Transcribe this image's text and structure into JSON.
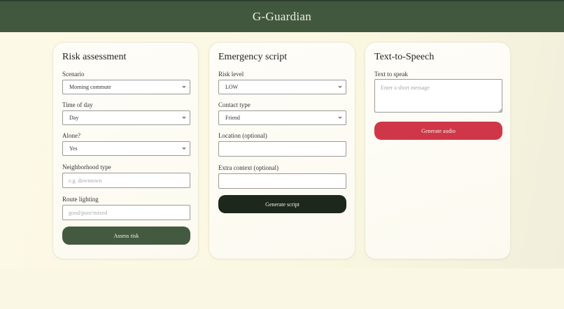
{
  "app": {
    "title": "G-Guardian"
  },
  "colors": {
    "header": "#41583f",
    "assess": "#435a41",
    "script": "#1d271c",
    "audio": "#cf3749"
  },
  "risk": {
    "title": "Risk assessment",
    "scenario": {
      "label": "Scenario",
      "value": "Morning commute"
    },
    "time": {
      "label": "Time of day",
      "value": "Day"
    },
    "alone": {
      "label": "Alone?",
      "value": "Yes"
    },
    "neighborhood": {
      "label": "Neighborhood type",
      "placeholder": "e.g. downtown"
    },
    "lighting": {
      "label": "Route lighting",
      "placeholder": "good/poor/mixed"
    },
    "button": "Assess risk"
  },
  "script": {
    "title": "Emergency script",
    "risk_level": {
      "label": "Risk level",
      "value": "LOW"
    },
    "contact": {
      "label": "Contact type",
      "value": "Friend"
    },
    "location": {
      "label": "Location (optional)",
      "placeholder": ""
    },
    "extra": {
      "label": "Extra context (optional)",
      "placeholder": ""
    },
    "button": "Generate script"
  },
  "tts": {
    "title": "Text-to-Speech",
    "text": {
      "label": "Text to speak",
      "placeholder": "Enter a short message"
    },
    "button": "Generate audio"
  }
}
